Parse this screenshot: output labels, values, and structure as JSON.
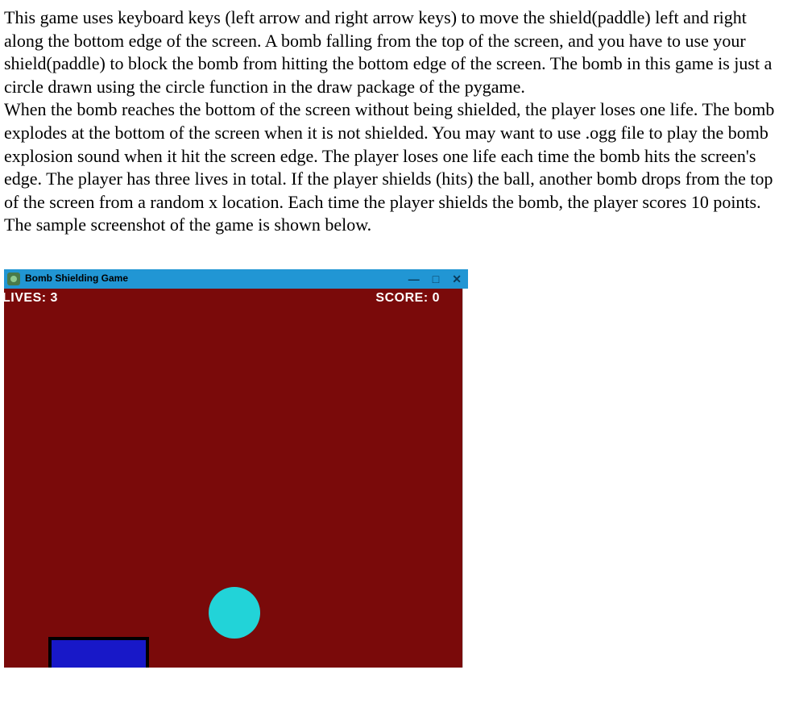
{
  "description": {
    "p1": "This game uses keyboard keys (left arrow and right arrow keys) to move the shield(paddle) left and right along the bottom edge of the screen. A bomb falling from the top of the screen, and you have to use your shield(paddle) to block the bomb from hitting the bottom edge of the screen. The bomb in this game is just a circle drawn using the circle function in the draw package of the pygame.",
    "p2": "When the bomb reaches the bottom of the screen without being shielded, the player loses one life. The bomb explodes at the bottom of the screen when it is not shielded. You may want to use .ogg file to play the bomb explosion sound when it hit the screen edge. The player loses one life each time the bomb hits the screen's edge. The player has three lives in total. If the player shields (hits) the ball, another bomb drops from the top of the screen from a random x location. Each time the player shields the bomb, the player scores 10 points.",
    "p3": "The sample screenshot of the game is shown below."
  },
  "window": {
    "title": "Bomb Shielding Game",
    "minimize": "—",
    "maximize": "□",
    "close": "✕"
  },
  "game": {
    "lives_label": "LIVES: 3",
    "score_label": "SCORE: 0",
    "lives": 3,
    "score": 0,
    "points_per_shield": 10,
    "total_lives": 3,
    "bomb_color": "#22d3d8",
    "paddle_color": "#1818c8",
    "background_color": "#7a0a0a"
  }
}
